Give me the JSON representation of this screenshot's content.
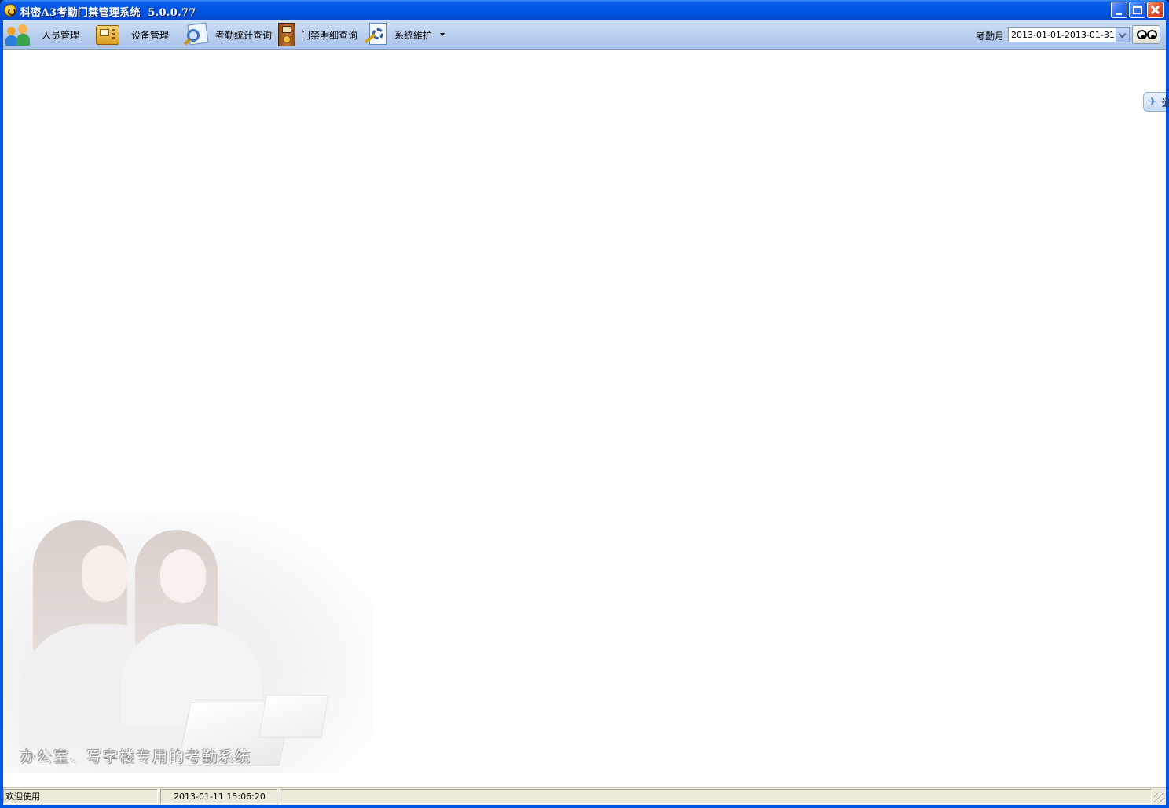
{
  "window": {
    "title": "科密A3考勤门禁管理系统  5.0.0.77",
    "icon": "app-logo-icon",
    "controls": [
      "minimize-icon",
      "maximize-icon",
      "close-icon"
    ]
  },
  "toolbar": {
    "items": [
      {
        "label": "人员管理",
        "icon": "people-icon"
      },
      {
        "label": "设备管理",
        "icon": "device-icon"
      },
      {
        "label": "考勤统计查询",
        "icon": "search-report-icon"
      },
      {
        "label": "门禁明细查询",
        "icon": "door-icon"
      },
      {
        "label": "系统維护",
        "icon": "system-tools-icon"
      }
    ],
    "month_label": "考勤月",
    "month_value": "2013-01-01-2013-01-31",
    "view_icon": "eyes-icon"
  },
  "side_tab": {
    "text": "通",
    "icon": "bird-icon"
  },
  "banner": {
    "slogan": "办公室、写字楼专用的考勤系统"
  },
  "statusbar": {
    "message": "欢迎使用",
    "datetime": "2013-01-11 15:06:20",
    "extra": ""
  },
  "colors": {
    "titlebar": "#0054e3",
    "toolbar": "#b9cfee",
    "statusbar": "#ece9d8"
  }
}
